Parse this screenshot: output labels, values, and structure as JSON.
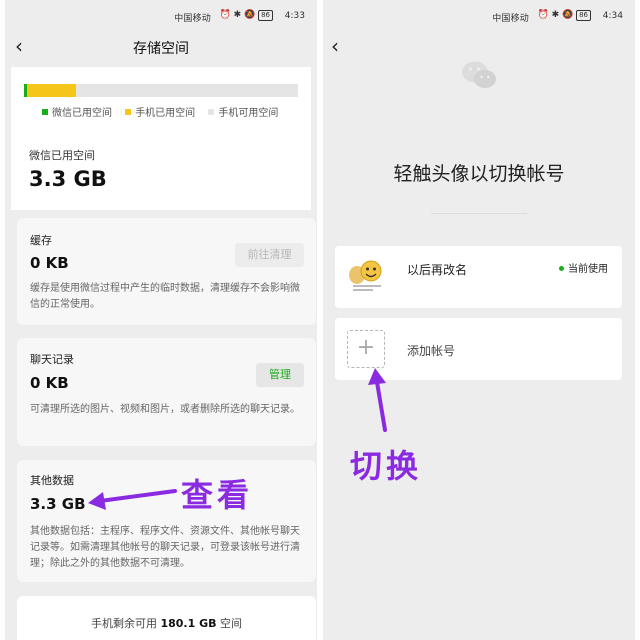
{
  "status_left": {
    "carrier": "中国移动",
    "time": "4:33",
    "battery": "86"
  },
  "status_right": {
    "carrier": "中国移动",
    "time": "4:34",
    "battery": "86"
  },
  "storage": {
    "title": "存储空间",
    "usage_bar": {
      "wechat_fraction": 0.01,
      "phone_fraction": 0.18
    },
    "legend": [
      "微信已用空间",
      "手机已用空间",
      "手机可用空间"
    ],
    "colors": {
      "wechat": "#1aad19",
      "phone": "#f5c518",
      "free": "#e5e5e5"
    },
    "used_label": "微信已用空间",
    "used_value": "3.3 GB",
    "cache": {
      "title": "缓存",
      "value": "0 KB",
      "button": "前往清理",
      "desc": "缓存是使用微信过程中产生的临时数据，清理缓存不会影响微信的正常使用。"
    },
    "chat": {
      "title": "聊天记录",
      "value": "0 KB",
      "button": "管理",
      "desc": "可清理所选的图片、视频和图片，或者删除所选的聊天记录。"
    },
    "other": {
      "title": "其他数据",
      "value": "3.3 GB",
      "desc": "其他数据包括：主程序、程序文件、资源文件、其他帐号聊天记录等。如需清理其他帐号的聊天记录，可登录该帐号进行清理；除此之外的其他数据不可清理。"
    },
    "free": {
      "prefix": "手机剩余可用",
      "value": "180.1 GB",
      "suffix": "空间"
    },
    "annotation": "查看"
  },
  "switcher": {
    "title": "轻触头像以切换帐号",
    "account": {
      "name": "以后再改名",
      "status": "当前使用",
      "avatar_icon": "emoji-avatar-icon"
    },
    "add": {
      "label": "添加帐号",
      "icon": "plus-icon"
    },
    "annotation": "切换"
  },
  "accent": "#8a2be2"
}
